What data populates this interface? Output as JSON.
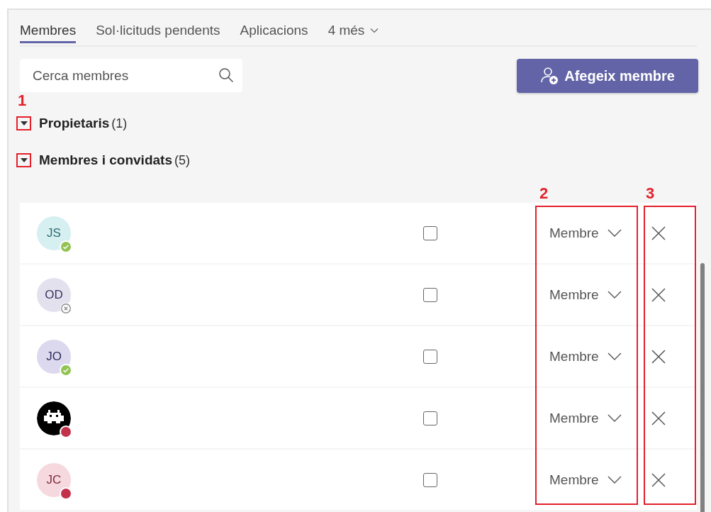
{
  "tabs": [
    {
      "label": "Membres",
      "selected": true
    },
    {
      "label": "Sol·licituds pendents",
      "selected": false
    },
    {
      "label": "Aplicacions",
      "selected": false
    },
    {
      "label": "4 més",
      "selected": false,
      "kind": "more"
    }
  ],
  "search": {
    "placeholder": "Cerca membres"
  },
  "add_button": {
    "label": "Afegeix membre"
  },
  "groups": [
    {
      "title": "Propietaris",
      "count": "(1)",
      "expanded": true,
      "annotation": "1"
    },
    {
      "title": "Membres i convidats",
      "count": "(5)",
      "expanded": true
    }
  ],
  "column_annotations": [
    "2",
    "3"
  ],
  "members": [
    {
      "kind": "initials",
      "initials": "JS",
      "color": "#d6eff1",
      "presence": {
        "kind": "available",
        "color": "#92c353"
      },
      "checked": false,
      "role": "Membre"
    },
    {
      "kind": "initials",
      "initials": "OD",
      "color": "#e4e1ef",
      "presence": {
        "kind": "offline",
        "color": "#8a8a8a"
      },
      "checked": false,
      "role": "Membre"
    },
    {
      "kind": "initials",
      "initials": "JO",
      "color": "#dcd9ee",
      "presence": {
        "kind": "available",
        "color": "#92c353"
      },
      "checked": false,
      "role": "Membre"
    },
    {
      "kind": "picture",
      "presence": {
        "kind": "busy",
        "color": "#c4314b"
      },
      "checked": false,
      "role": "Membre"
    },
    {
      "kind": "initials",
      "initials": "JC",
      "color": "#f6d9de",
      "presence": {
        "kind": "busy",
        "color": "#c4314b"
      },
      "checked": false,
      "role": "Membre"
    }
  ]
}
